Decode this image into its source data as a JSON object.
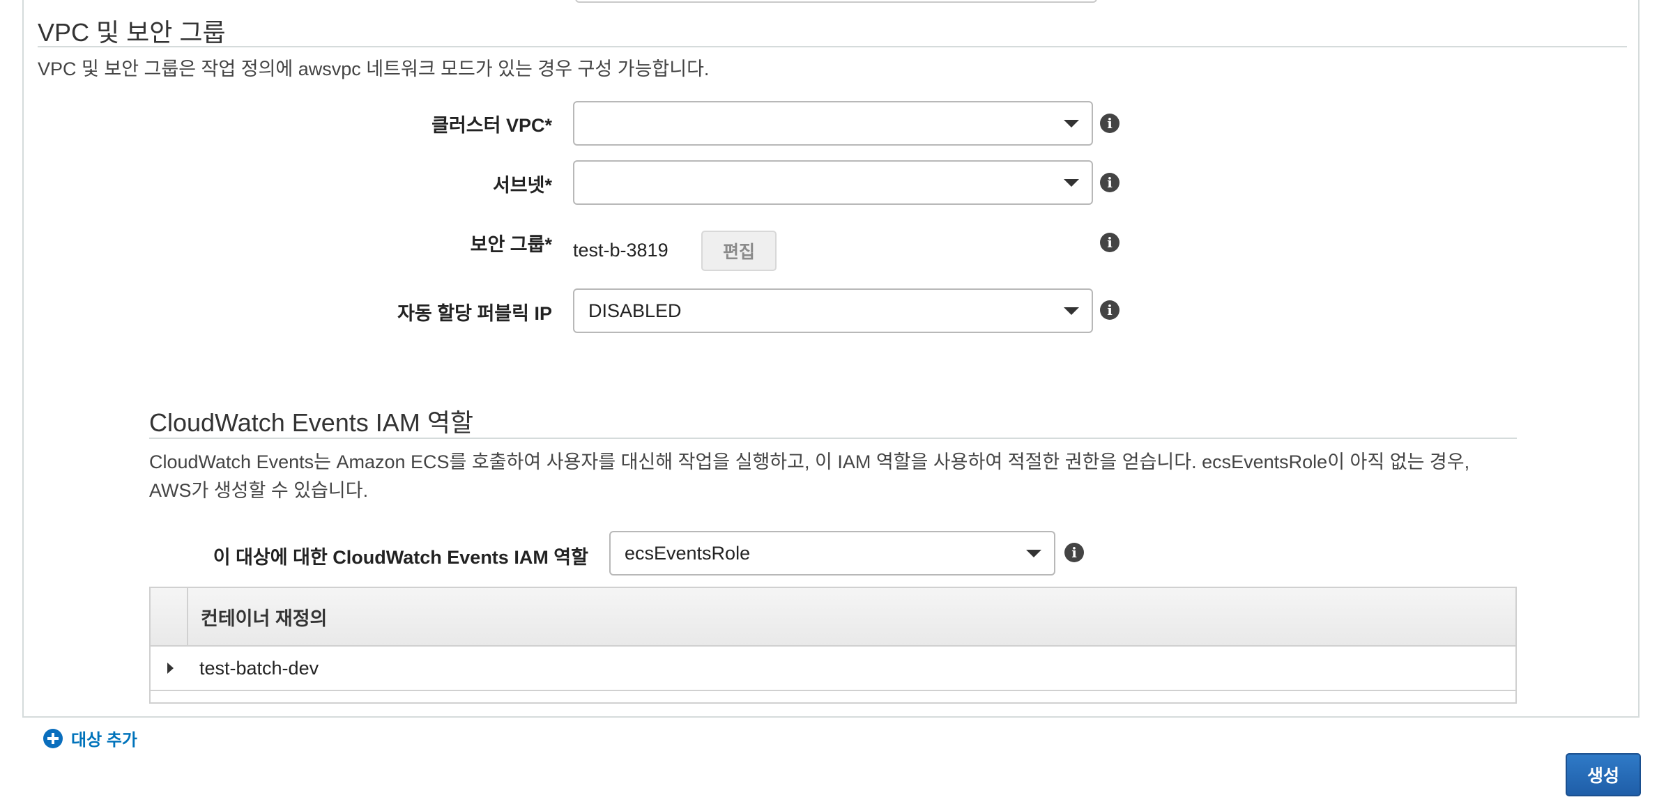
{
  "vpc_section": {
    "title": "VPC 및 보안 그룹",
    "description": "VPC 및 보안 그룹은 작업 정의에 awsvpc 네트워크 모드가 있는 경우 구성 가능합니다.",
    "cluster_vpc": {
      "label": "클러스터 VPC*",
      "value": ""
    },
    "subnet": {
      "label": "서브넷*",
      "value": ""
    },
    "security_group": {
      "label": "보안 그룹*",
      "value": "test-b-3819",
      "edit_label": "편집"
    },
    "public_ip": {
      "label": "자동 할당 퍼블릭 IP",
      "value": "DISABLED"
    }
  },
  "iam_section": {
    "title": "CloudWatch Events IAM 역할",
    "description_line1": "CloudWatch Events는 Amazon ECS를 호출하여 사용자를 대신해 작업을 실행하고, 이 IAM 역할을 사용하여 적절한 권한을 얻습니다. ecsEventsRole이 아직 없는 경우,",
    "description_line2": "AWS가 생성할 수 있습니다.",
    "role": {
      "label": "이 대상에 대한 CloudWatch Events IAM 역할",
      "value": "ecsEventsRole"
    }
  },
  "container_table": {
    "header": "컨테이너 재정의",
    "rows": [
      {
        "name": "test-batch-dev"
      }
    ]
  },
  "footer": {
    "add_target_label": "대상 추가",
    "create_label": "생성"
  },
  "icons": {
    "info": "info-icon",
    "dropdown": "chevron-down-icon",
    "expand": "caret-right-icon",
    "add": "plus-circle-icon"
  },
  "colors": {
    "link": "#0073bb",
    "primary_button": "#1f5ea8"
  }
}
